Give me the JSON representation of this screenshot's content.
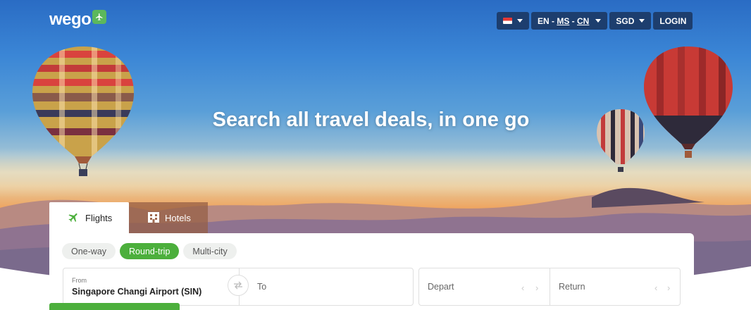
{
  "header": {
    "logo_text": "wego",
    "language": {
      "en": "EN",
      "sep1": " - ",
      "ms": "MS",
      "sep2": " - ",
      "cn": "CN"
    },
    "currency": "SGD",
    "login": "LOGIN"
  },
  "hero": {
    "headline": "Search all travel deals, in one go"
  },
  "tabs": [
    {
      "label": "Flights",
      "icon": "airplane-icon",
      "active": true
    },
    {
      "label": "Hotels",
      "icon": "building-icon",
      "active": false
    }
  ],
  "trip_types": [
    {
      "label": "One-way",
      "active": false
    },
    {
      "label": "Round-trip",
      "active": true
    },
    {
      "label": "Multi-city",
      "active": false
    }
  ],
  "search": {
    "from_label": "From",
    "from_value": "Singapore Changi Airport (SIN)",
    "to_placeholder": "To",
    "depart_placeholder": "Depart",
    "return_placeholder": "Return"
  },
  "colors": {
    "accent_green": "#4caf3c",
    "nav_bg": "#1d3e6e",
    "sky_top": "#2a6cc4"
  }
}
